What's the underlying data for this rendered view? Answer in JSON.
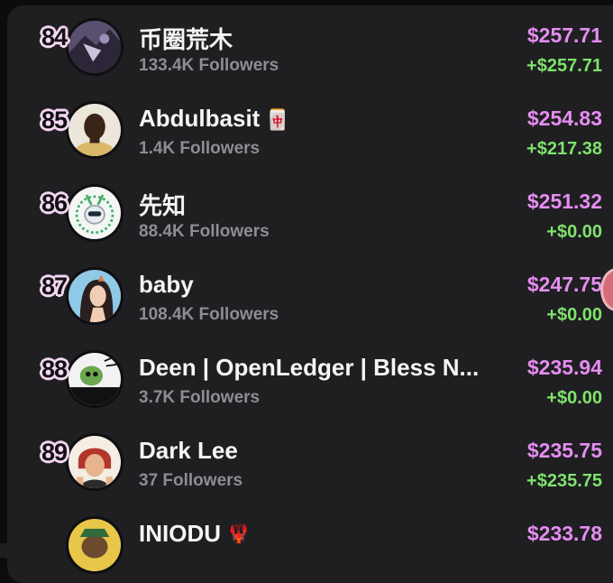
{
  "rows": [
    {
      "rank": "84",
      "name": "币圈荒木",
      "emoji": "",
      "followers": "133.4K Followers",
      "amount": "$257.71",
      "delta": "+$257.71"
    },
    {
      "rank": "85",
      "name": "Abdulbasit",
      "emoji": "🀄",
      "followers": "1.4K Followers",
      "amount": "$254.83",
      "delta": "+$217.38"
    },
    {
      "rank": "86",
      "name": "先知",
      "emoji": "",
      "followers": "88.4K Followers",
      "amount": "$251.32",
      "delta": "+$0.00"
    },
    {
      "rank": "87",
      "name": "baby",
      "emoji": "",
      "followers": "108.4K Followers",
      "amount": "$247.75",
      "delta": "+$0.00"
    },
    {
      "rank": "88",
      "name": "Deen | OpenLedger | Bless N...",
      "emoji": "",
      "followers": "3.7K Followers",
      "amount": "$235.94",
      "delta": "+$0.00"
    },
    {
      "rank": "89",
      "name": "Dark Lee",
      "emoji": "",
      "followers": "37 Followers",
      "amount": "$235.75",
      "delta": "+$235.75"
    },
    {
      "rank": "",
      "name": "INIODU",
      "emoji": "🦞",
      "followers": "",
      "amount": "$233.78",
      "delta": ""
    }
  ],
  "colors": {
    "amount": "#e58df0",
    "delta": "#7ee26b",
    "followers": "#8d8d92",
    "panel": "#1f1f21"
  }
}
